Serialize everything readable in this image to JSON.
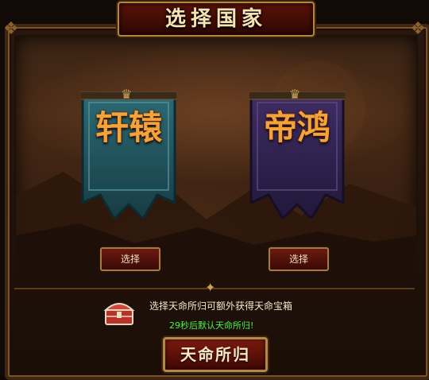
{
  "dialog": {
    "title": "选择国家",
    "factions": [
      {
        "name": "轩辕",
        "select_label": "选择",
        "banner_color": "#1f4f57"
      },
      {
        "name": "帝鸿",
        "select_label": "选择",
        "banner_color": "#2a1d44"
      }
    ],
    "reward": {
      "icon": "treasure-chest-icon",
      "message": "选择天命所归可额外获得天命宝箱",
      "countdown_text": "29秒后默认天命所归!"
    },
    "confirm_label": "天命所归"
  },
  "colors": {
    "accent": "#b2894c",
    "button_red": "#5a1309",
    "faction_text": "#f4a23a",
    "countdown": "#4df24d"
  }
}
